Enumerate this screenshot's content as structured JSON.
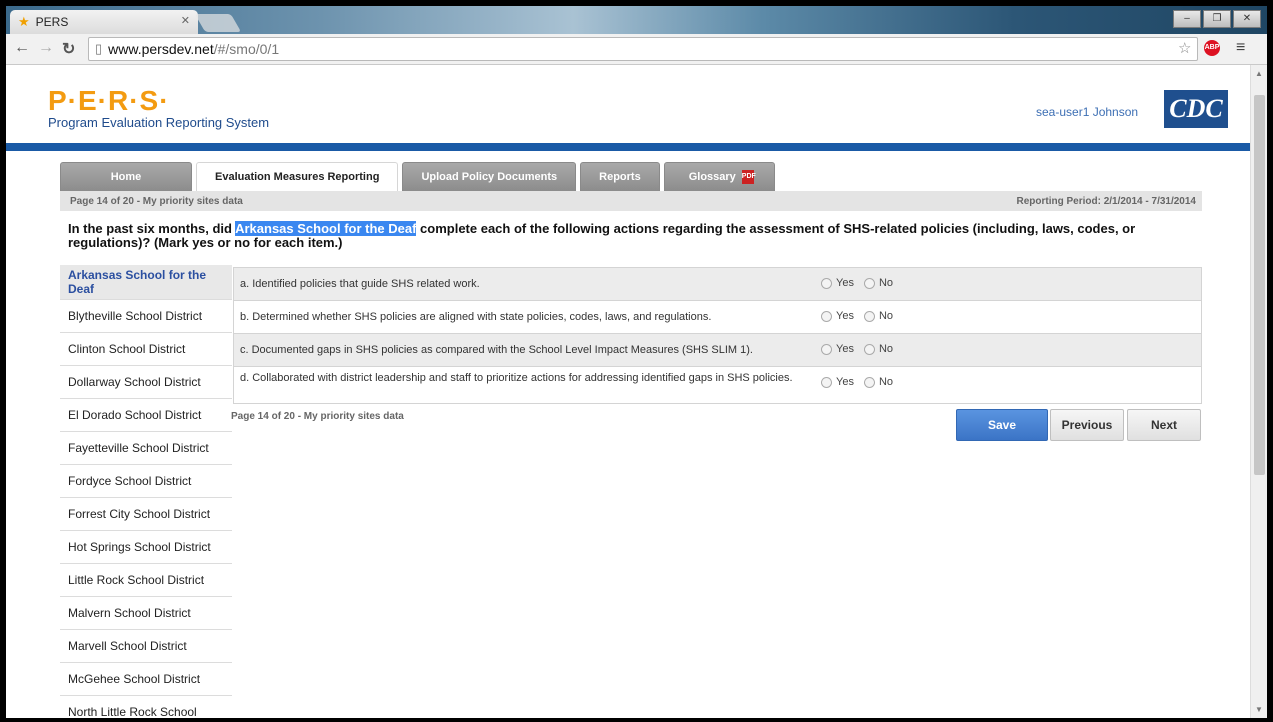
{
  "browser": {
    "tab_title": "PERS",
    "url_host": "www.persdev.net",
    "url_path": "/#/smo/0/1",
    "abp_label": "ABP"
  },
  "header": {
    "logo": "P·E·R·S·",
    "subtitle": "Program Evaluation Reporting System",
    "user": "sea-user1 Johnson",
    "cdc": "CDC"
  },
  "tabs": [
    {
      "label": "Home"
    },
    {
      "label": "Evaluation Measures Reporting"
    },
    {
      "label": "Upload Policy Documents"
    },
    {
      "label": "Reports"
    },
    {
      "label": "Glossary"
    }
  ],
  "pdf_label": "PDF",
  "infobar": {
    "page_info": "Page 14 of 20 - My priority sites data",
    "reporting_period": "Reporting Period: 2/1/2014 - 7/31/2014"
  },
  "question": {
    "prefix": "In the past six months, did ",
    "highlight": "Arkansas School for the Deaf",
    "suffix": " complete each of the following actions regarding the assessment of SHS-related policies (including, laws, codes, or regulations)? (Mark yes or no for each item.)"
  },
  "schools": [
    "Arkansas School for the Deaf",
    "Blytheville School District",
    "Clinton School District",
    "Dollarway School District",
    "El Dorado School District",
    "Fayetteville School District",
    "Fordyce School District",
    "Forrest City School District",
    "Hot Springs School District",
    "Little Rock School District",
    "Malvern School District",
    "Marvell School District",
    "McGehee School District",
    "North Little Rock School"
  ],
  "items": [
    {
      "text": "a. Identified policies that guide SHS related work."
    },
    {
      "text": "b. Determined whether SHS policies are aligned with state policies, codes, laws, and regulations."
    },
    {
      "text": "c. Documented gaps in SHS policies as compared with the School Level Impact Measures (SHS SLIM 1)."
    },
    {
      "text": "d. Collaborated with district leadership and staff to prioritize actions for addressing identified gaps in SHS policies."
    }
  ],
  "options": {
    "yes": "Yes",
    "no": "No"
  },
  "footer": {
    "page_info": "Page 14 of 20 - My priority sites data"
  },
  "buttons": {
    "save": "Save",
    "previous": "Previous",
    "next": "Next"
  }
}
